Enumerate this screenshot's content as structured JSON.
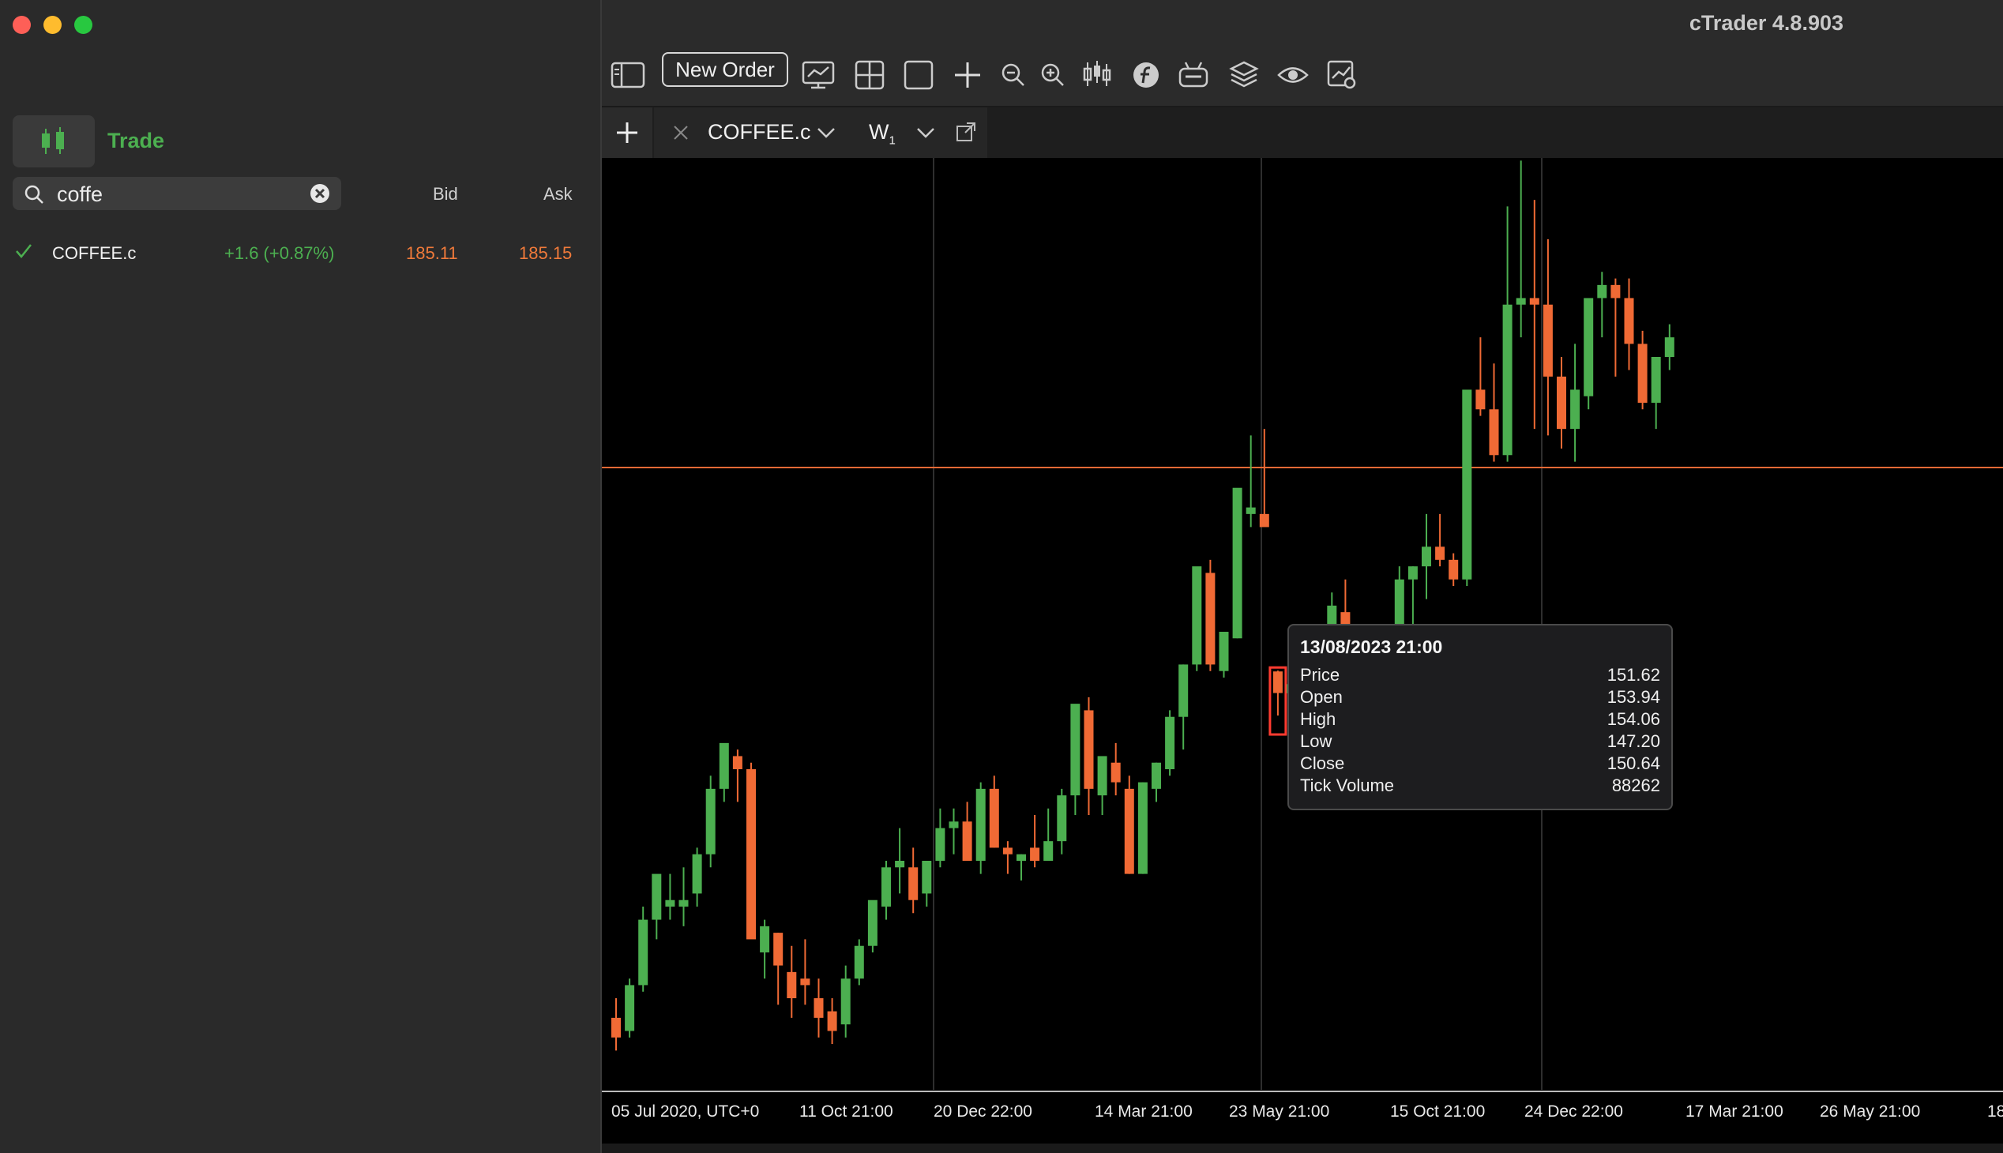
{
  "window": {
    "title": "cTrader 4.8.903",
    "traffic_lights": [
      "close",
      "minimize",
      "zoom"
    ]
  },
  "sidebar": {
    "section_title": "Trade",
    "search": {
      "value": "coffe",
      "placeholder": ""
    },
    "columns": {
      "bid": "Bid",
      "ask": "Ask"
    },
    "symbols": [
      {
        "name": "COFFEE.c",
        "change": "+1.6 (+0.87%)",
        "bid": "185.11",
        "ask": "185.15"
      }
    ]
  },
  "toolbar": {
    "new_order_label": "New Order",
    "icons": [
      "sidebar-toggle-icon",
      "chart-monitor-icon",
      "grid-layout-icon",
      "single-layout-icon",
      "crosshair-icon",
      "zoom-out-icon",
      "zoom-in-icon",
      "chart-type-icon",
      "fibonacci-icon",
      "bot-icon",
      "layers-icon",
      "eye-icon",
      "chart-settings-icon"
    ]
  },
  "tab": {
    "symbol": "COFFEE.c",
    "timeframe": "W",
    "timeframe_sub": "1"
  },
  "chart": {
    "x_labels": [
      "05 Jul 2020, UTC+0",
      "11 Oct 21:00",
      "20 Dec 22:00",
      "14 Mar 21:00",
      "23 May 21:00",
      "15 Oct 21:00",
      "24 Dec 22:00",
      "17 Mar 21:00",
      "26 May 21:00",
      "18"
    ],
    "current_price": 185.11,
    "colors": {
      "up": "#4caf50",
      "down": "#f06a35",
      "price_line": "#f06a35",
      "highlight": "#ff3b30"
    }
  },
  "tooltip": {
    "date": "13/08/2023 21:00",
    "rows": [
      {
        "label": "Price",
        "value": "151.62"
      },
      {
        "label": "Open",
        "value": "153.94"
      },
      {
        "label": "High",
        "value": "154.06"
      },
      {
        "label": "Low",
        "value": "147.20"
      },
      {
        "label": "Close",
        "value": "150.64"
      },
      {
        "label": "Tick Volume",
        "value": "88262"
      }
    ]
  },
  "chart_data": {
    "type": "candlestick",
    "title": "",
    "ohlc": [
      [
        101,
        104,
        96,
        98
      ],
      [
        99,
        107,
        98,
        106
      ],
      [
        106,
        118,
        105,
        116
      ],
      [
        116,
        122,
        113,
        123
      ],
      [
        118,
        123,
        116,
        119
      ],
      [
        118,
        124,
        115,
        119
      ],
      [
        120,
        127,
        118,
        126
      ],
      [
        126,
        138,
        124,
        136
      ],
      [
        136,
        142,
        134,
        143
      ],
      [
        141,
        142,
        134,
        139
      ],
      [
        139,
        140,
        114,
        113
      ],
      [
        111,
        116,
        107,
        115
      ],
      [
        114,
        114,
        103,
        109
      ],
      [
        108,
        112,
        101,
        104
      ],
      [
        107,
        113,
        103,
        106
      ],
      [
        104,
        107,
        98,
        101
      ],
      [
        102,
        104,
        97,
        99
      ],
      [
        100,
        109,
        98,
        107
      ],
      [
        107,
        113,
        106,
        112
      ],
      [
        112,
        118,
        111,
        119
      ],
      [
        118,
        125,
        116,
        124
      ],
      [
        124,
        130,
        120,
        125
      ],
      [
        124,
        127,
        117,
        119
      ],
      [
        120,
        125,
        118,
        125
      ],
      [
        125,
        133,
        124,
        130
      ],
      [
        130,
        133,
        126,
        131
      ],
      [
        131,
        134,
        125,
        125
      ],
      [
        125,
        137,
        123,
        136
      ],
      [
        136,
        138,
        127,
        127
      ],
      [
        127,
        128,
        123,
        126
      ],
      [
        125,
        126,
        122,
        126
      ],
      [
        127,
        132,
        124,
        125
      ],
      [
        125,
        133,
        125,
        128
      ],
      [
        128,
        136,
        126,
        135
      ],
      [
        135,
        148,
        132,
        149
      ],
      [
        148,
        150,
        132,
        136
      ],
      [
        135,
        140,
        132,
        141
      ],
      [
        140,
        143,
        135,
        137
      ],
      [
        136,
        138,
        123,
        123
      ],
      [
        123,
        137,
        123,
        137
      ],
      [
        136,
        140,
        134,
        140
      ],
      [
        139,
        148,
        138,
        147
      ],
      [
        147,
        155,
        142,
        155
      ],
      [
        155,
        163,
        154,
        170
      ],
      [
        169,
        171,
        154,
        155
      ],
      [
        154,
        158,
        153,
        160
      ],
      [
        159,
        178,
        159,
        182
      ],
      [
        178,
        190,
        176,
        179
      ],
      [
        178,
        191,
        177,
        176
      ],
      [
        153.94,
        154.06,
        147.2,
        150.64
      ],
      [
        150.6,
        155,
        149,
        152
      ],
      [
        152,
        158,
        151,
        151
      ],
      [
        151,
        154,
        146,
        149
      ],
      [
        147,
        166,
        146,
        164
      ],
      [
        163,
        168,
        150,
        151
      ],
      [
        150,
        153,
        142,
        146
      ],
      [
        144,
        148,
        140,
        149
      ],
      [
        149,
        160,
        147,
        161
      ],
      [
        161,
        170,
        160,
        168
      ],
      [
        168,
        170,
        160,
        170
      ],
      [
        170,
        178,
        165,
        173
      ],
      [
        173,
        178,
        170,
        171
      ],
      [
        171,
        172,
        167,
        168
      ],
      [
        168,
        178,
        167,
        197
      ],
      [
        197,
        205,
        193,
        194
      ],
      [
        194,
        201,
        186,
        187
      ],
      [
        187,
        225,
        186,
        210
      ],
      [
        210,
        232,
        205,
        211
      ],
      [
        211,
        226,
        191,
        210
      ],
      [
        210,
        220,
        190,
        199
      ],
      [
        199,
        202,
        188,
        191
      ],
      [
        191,
        204,
        186,
        197
      ],
      [
        196,
        209,
        194,
        211
      ],
      [
        211,
        215,
        205,
        213
      ],
      [
        213,
        214,
        199,
        211
      ],
      [
        211,
        214,
        200,
        204
      ],
      [
        204,
        206,
        194,
        195
      ],
      [
        195,
        200,
        191,
        202
      ],
      [
        202,
        207,
        200,
        205
      ]
    ],
    "ylim": [
      90,
      230
    ],
    "current_price": 185.11
  }
}
